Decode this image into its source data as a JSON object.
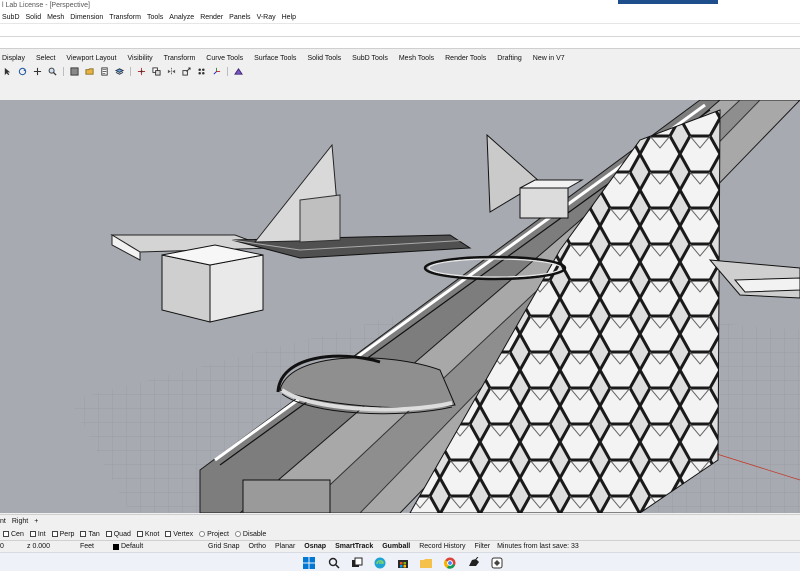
{
  "window": {
    "title": "l Lab License - [Perspective]"
  },
  "menu": [
    "SubD",
    "Solid",
    "Mesh",
    "Dimension",
    "Transform",
    "Tools",
    "Analyze",
    "Render",
    "Panels",
    "V-Ray",
    "Help"
  ],
  "toolbar_tabs": [
    "Display",
    "Select",
    "Viewport Layout",
    "Visibility",
    "Transform",
    "Curve Tools",
    "Surface Tools",
    "Solid Tools",
    "SubD Tools",
    "Mesh Tools",
    "Render Tools",
    "Drafting",
    "New in V7"
  ],
  "toolbar_icons": [
    "select-icon",
    "rotate-view-icon",
    "pan-icon",
    "zoom-icon",
    "shade-icon",
    "open-icon",
    "properties-icon",
    "layers-icon",
    "move-icon",
    "copy-icon",
    "mirror-icon",
    "scale-icon",
    "array-icon",
    "gumball-icon",
    "render-icon"
  ],
  "viewport_tabs": [
    "nt",
    "Right",
    "+"
  ],
  "osnaps": [
    {
      "label": "Cen",
      "checked": false
    },
    {
      "label": "Int",
      "checked": false
    },
    {
      "label": "Perp",
      "checked": false
    },
    {
      "label": "Tan",
      "checked": false
    },
    {
      "label": "Quad",
      "checked": false
    },
    {
      "label": "Knot",
      "checked": false
    },
    {
      "label": "Vertex",
      "checked": false
    }
  ],
  "osnap_radios": [
    "Project",
    "Disable"
  ],
  "status": {
    "coord": "0",
    "z": "z 0.000",
    "units": "Feet",
    "layer": "Default",
    "toggles": [
      "Grid Snap",
      "Ortho",
      "Planar",
      "Osnap",
      "SmartTrack",
      "Gumball",
      "Record History",
      "Filter"
    ],
    "bold_toggles": [
      "Osnap",
      "SmartTrack",
      "Gumball"
    ],
    "save_info": "Minutes from last save: 33"
  },
  "taskbar_icons": [
    "windows-start-icon",
    "search-icon",
    "task-view-icon",
    "edge-icon",
    "store-icon",
    "file-explorer-icon",
    "chrome-icon",
    "rhino-icon",
    "app-icon"
  ],
  "colors": {
    "viewport_bg": "#a7abb1",
    "accent": "#1f4e8c"
  }
}
